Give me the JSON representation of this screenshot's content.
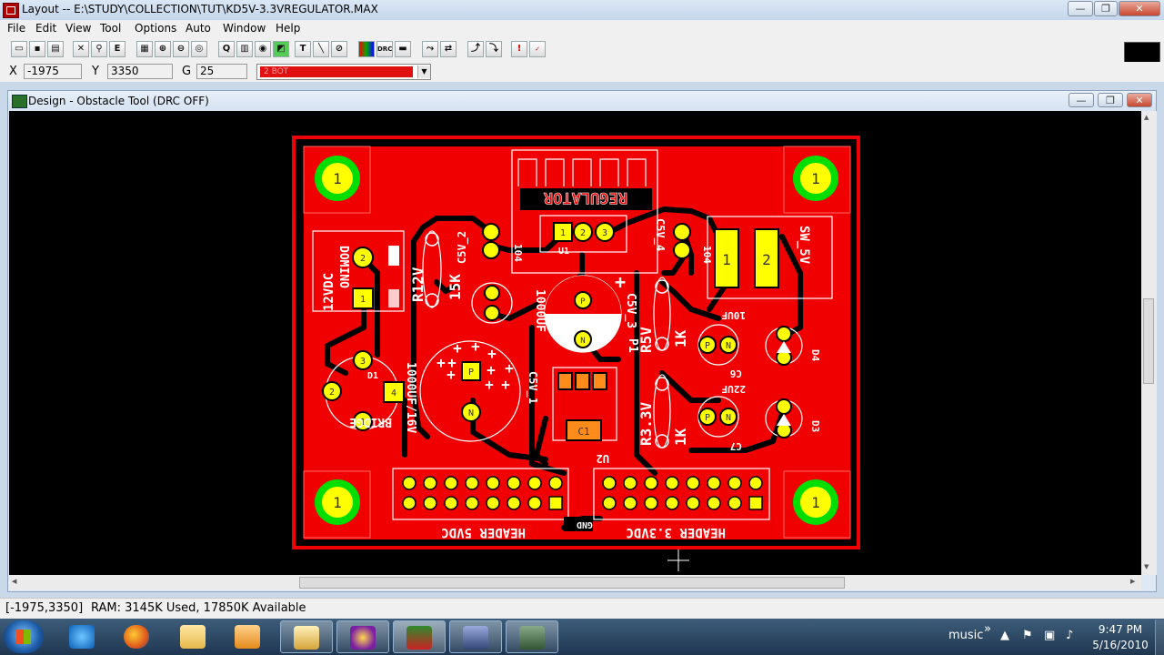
{
  "window": {
    "title": "Layout -- E:\\STUDY\\COLLECTION\\TUT\\KD5V-3.3VREGULATOR.MAX",
    "min": "—",
    "max": "❐",
    "close": "✕"
  },
  "menu": [
    "File",
    "Edit",
    "View",
    "Tool",
    "Options",
    "Auto",
    "Window",
    "Help"
  ],
  "coords": {
    "x_label": "X",
    "x_value": "-1975",
    "y_label": "Y",
    "y_value": "3350",
    "g_label": "G",
    "g_value": "25",
    "layer": "2 BOT",
    "layer_color": "#e01010"
  },
  "design": {
    "title": "Design - Obstacle Tool (DRC OFF)"
  },
  "board": {
    "labels": {
      "regulator": "REGULATOR",
      "sw5v": "SW_5V",
      "v12dc": "12VDC",
      "domino": "DOMINO",
      "bridge": "BRIDGE",
      "d1": "D1",
      "r12v": "R12V",
      "k15": "15K",
      "c5v2": "C5V_2",
      "c5v4": "C5V_4",
      "u1": "U1",
      "n104a": "104",
      "n104b": "104",
      "n1000uf": "1000UF",
      "c5v3": "C5V_3",
      "p1": "P1",
      "cap1000": "1000UF/16V",
      "c5v1": "C5V_1",
      "c1": "C1",
      "u2": "U2",
      "r5v": "R5V",
      "k1a": "1K",
      "r33v": "R3.3V",
      "k1b": "1K",
      "uf10": "10UF",
      "c6": "C6",
      "uf22": "22UF",
      "c7": "C7",
      "d4": "D4",
      "d3": "D3",
      "hdr5": "HEADER 5VDC",
      "hdr33": "HEADER 3.3VDC",
      "gnd": "GND",
      "pin1": "1",
      "pin2": "2",
      "pin3": "3",
      "pin4": "4",
      "pinP": "P",
      "pinN": "N"
    },
    "colors": {
      "board": "#f00000",
      "copper": "#f00000",
      "pad": "#ffff00",
      "pad_ring": "#00dd00",
      "silk": "#ffffff",
      "orange": "#ff8c1a"
    }
  },
  "status": {
    "coord": "[-1975,3350]",
    "ram": "RAM: 3145K Used, 17850K Available"
  },
  "taskbar": {
    "tray_label": "music",
    "time": "9:47 PM",
    "date": "5/16/2010",
    "tray_expand": "»"
  }
}
